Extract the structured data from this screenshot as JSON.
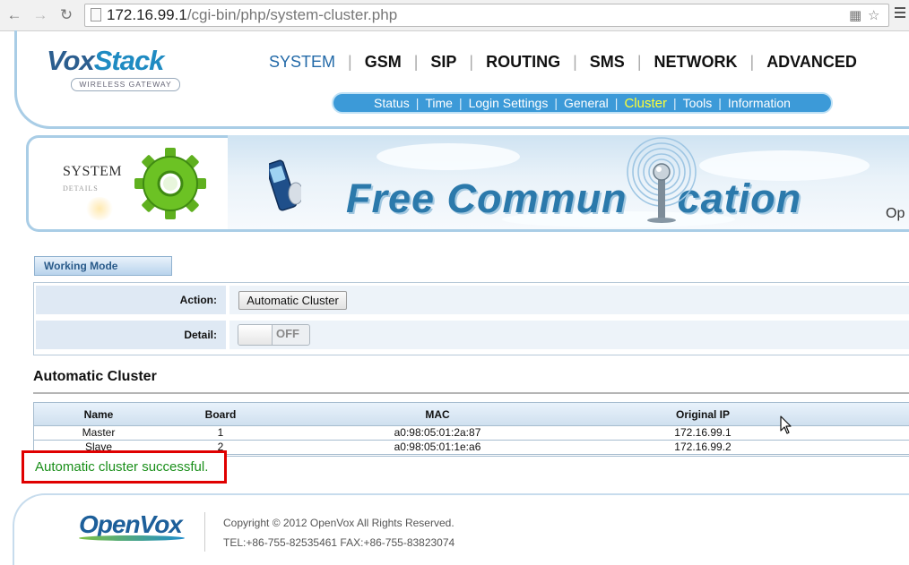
{
  "browser": {
    "url_host": "172.16.99.1",
    "url_path": "/cgi-bin/php/system-cluster.php"
  },
  "logo": {
    "part1": "Vox",
    "part2": "Stack",
    "tagline": "WIRELESS GATEWAY"
  },
  "main_nav": [
    {
      "label": "SYSTEM",
      "active": true
    },
    {
      "label": "GSM",
      "active": false
    },
    {
      "label": "SIP",
      "active": false
    },
    {
      "label": "ROUTING",
      "active": false
    },
    {
      "label": "SMS",
      "active": false
    },
    {
      "label": "NETWORK",
      "active": false
    },
    {
      "label": "ADVANCED",
      "active": false
    }
  ],
  "sub_nav": [
    {
      "label": "Status",
      "active": false
    },
    {
      "label": "Time",
      "active": false
    },
    {
      "label": "Login Settings",
      "active": false
    },
    {
      "label": "General",
      "active": false
    },
    {
      "label": "Cluster",
      "active": true
    },
    {
      "label": "Tools",
      "active": false
    },
    {
      "label": "Information",
      "active": false
    }
  ],
  "banner": {
    "section_title": "SYSTEM",
    "section_subtitle": "DETAILS",
    "slogan_part1": "Free Commun",
    "slogan_part2": "cation",
    "right_text": "Op"
  },
  "working_mode": {
    "tab_label": "Working Mode",
    "action_label": "Action:",
    "action_button": "Automatic Cluster",
    "detail_label": "Detail:",
    "detail_toggle": "OFF"
  },
  "cluster": {
    "title": "Automatic Cluster",
    "columns": [
      "Name",
      "Board",
      "MAC",
      "Original IP"
    ],
    "rows": [
      {
        "name": "Master",
        "board": "1",
        "mac": "a0:98:05:01:2a:87",
        "ip": "172.16.99.1"
      },
      {
        "name": "Slave",
        "board": "2",
        "mac": "a0:98:05:01:1e:a6",
        "ip": "172.16.99.2"
      }
    ],
    "status": "Automatic cluster successful."
  },
  "footer": {
    "logo": "OpenVox",
    "copyright": "Copyright © 2012 OpenVox All Rights Reserved.",
    "contact": "TEL:+86-755-82535461 FAX:+86-755-83823074"
  },
  "colors": {
    "primary_blue": "#2269a8",
    "subnav_blue": "#3c9ad8",
    "active_subnav": "#ffff33",
    "success_green": "#1a8f1a",
    "highlight_red": "#e00000"
  }
}
